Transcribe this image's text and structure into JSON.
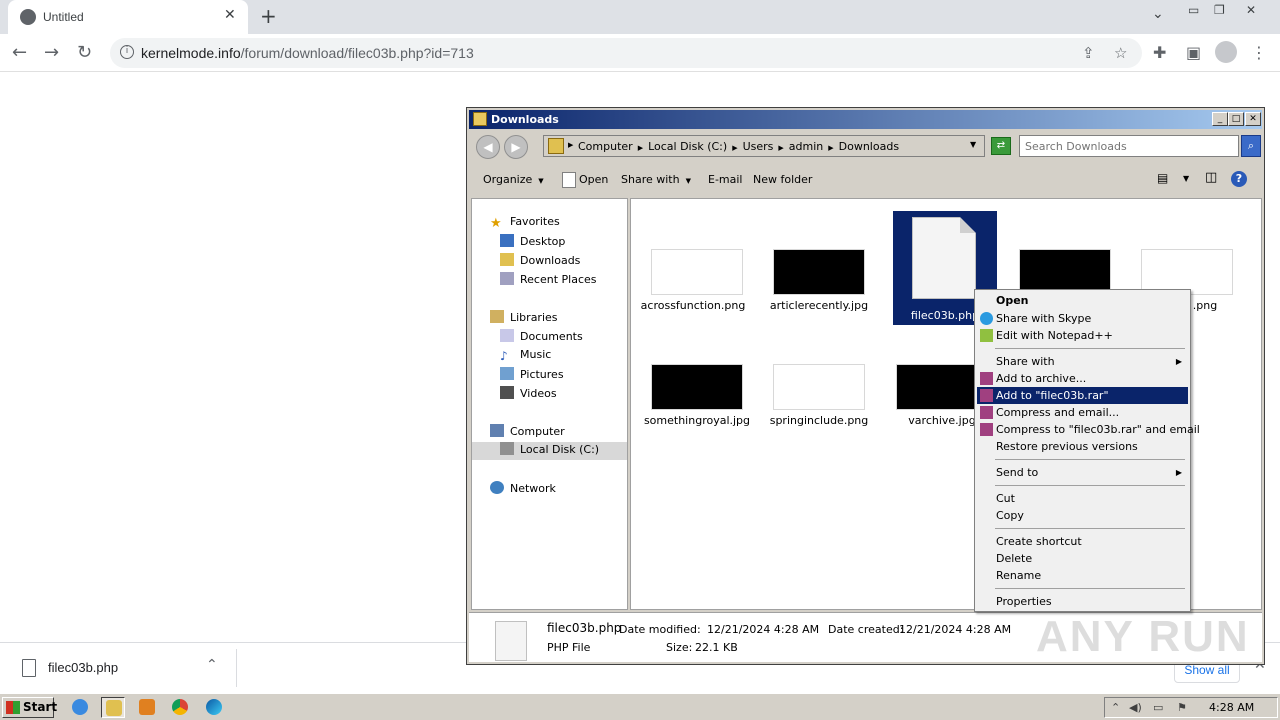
{
  "browser": {
    "tab_title": "Untitled",
    "url_domain": "kernelmode.info",
    "url_path": "/forum/download/filec03b.php?id=713"
  },
  "download_shelf": {
    "filename": "filec03b.php",
    "show_all": "Show all"
  },
  "explorer": {
    "title": "Downloads",
    "breadcrumbs": [
      "Computer",
      "Local Disk (C:)",
      "Users",
      "admin",
      "Downloads"
    ],
    "search_placeholder": "Search Downloads",
    "toolbar": {
      "organize": "Organize",
      "open": "Open",
      "share_with": "Share with",
      "email": "E-mail",
      "new_folder": "New folder"
    },
    "nav": {
      "favorites": "Favorites",
      "desktop": "Desktop",
      "downloads": "Downloads",
      "recent_places": "Recent Places",
      "libraries": "Libraries",
      "documents": "Documents",
      "music": "Music",
      "pictures": "Pictures",
      "videos": "Videos",
      "computer": "Computer",
      "local_disk": "Local Disk (C:)",
      "network": "Network"
    },
    "files": [
      {
        "name": "acrossfunction.png",
        "thumb": "#ffffff"
      },
      {
        "name": "articlerecently.jpg",
        "thumb": "#000000"
      },
      {
        "name": "filec03b.php",
        "thumb": "doc"
      },
      {
        "name": "",
        "thumb": "#000000"
      },
      {
        "name": ".png",
        "thumb": "#ffffff"
      },
      {
        "name": "somethingroyal.jpg",
        "thumb": "#000000"
      },
      {
        "name": "springinclude.png",
        "thumb": "#ffffff"
      },
      {
        "name": "varchive.jpg",
        "thumb": "#000000"
      }
    ],
    "details": {
      "filename": "filec03b.php",
      "type": "PHP File",
      "date_modified_label": "Date modified:",
      "date_modified": "12/21/2024 4:28 AM",
      "date_created_label": "Date created:",
      "date_created": "12/21/2024 4:28 AM",
      "size_label": "Size:",
      "size": "22.1 KB"
    }
  },
  "context_menu": {
    "items": [
      "Open",
      "Share with Skype",
      "Edit with Notepad++",
      "Share with",
      "Add to archive...",
      "Add to \"filec03b.rar\"",
      "Compress and email...",
      "Compress to \"filec03b.rar\" and email",
      "Restore previous versions",
      "Send to",
      "Cut",
      "Copy",
      "Create shortcut",
      "Delete",
      "Rename",
      "Properties"
    ]
  },
  "taskbar": {
    "start": "Start",
    "clock": "4:28 AM"
  },
  "watermark": "ANY RUN"
}
